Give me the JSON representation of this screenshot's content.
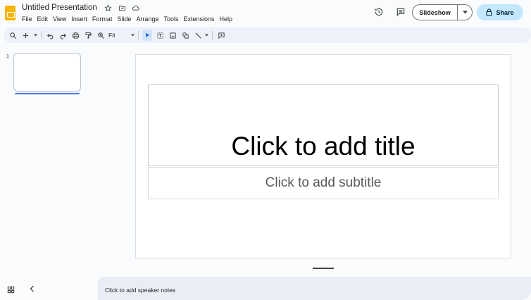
{
  "document": {
    "title": "Untitled Presentation"
  },
  "menu": [
    "File",
    "Edit",
    "View",
    "Insert",
    "Format",
    "Slide",
    "Arrange",
    "Tools",
    "Extensions",
    "Help"
  ],
  "header": {
    "slideshow_label": "Slideshow",
    "share_label": "Share",
    "icons": [
      "star-icon",
      "move-folder-icon",
      "cloud-status-icon",
      "history-icon",
      "comments-icon",
      "lock-icon"
    ]
  },
  "toolbar": {
    "zoom_label": "Fit",
    "icons": [
      "search-icon",
      "new-slide-icon",
      "undo-icon",
      "redo-icon",
      "print-icon",
      "paint-format-icon",
      "zoom-icon",
      "select-icon",
      "text-box-icon",
      "image-icon",
      "shape-icon",
      "line-icon",
      "comment-add-icon"
    ]
  },
  "filmstrip": {
    "slides": [
      {
        "number": "1"
      }
    ]
  },
  "slide": {
    "title_placeholder": "Click to add title",
    "subtitle_placeholder": "Click to add subtitle"
  },
  "notes": {
    "placeholder": "Click to add speaker notes"
  },
  "colors": {
    "background": "#f9fbfd",
    "toolbar": "#edf2fa",
    "share_button": "#c2e7ff",
    "logo": "#f6b300",
    "active_slide": "#4a7fd8"
  }
}
